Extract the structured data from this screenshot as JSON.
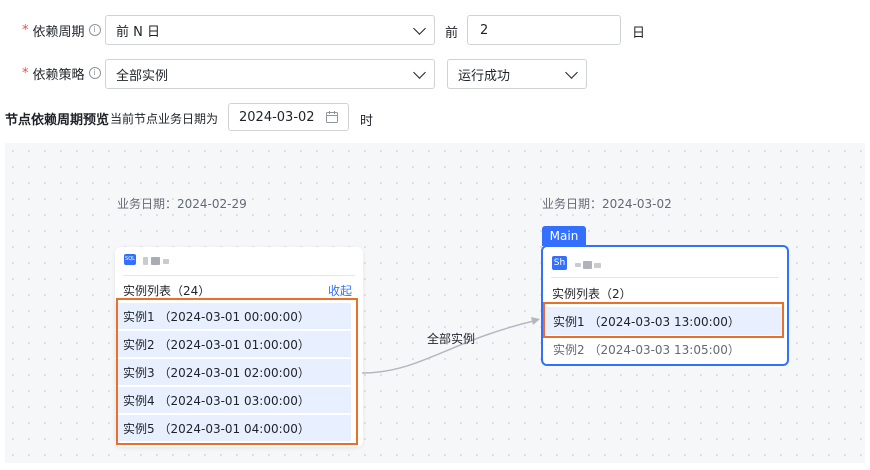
{
  "form": {
    "cycle": {
      "label": "依赖周期",
      "value": "前 N 日",
      "prefix": "前",
      "number": "2",
      "unit": "日"
    },
    "strategy": {
      "label": "依赖策略",
      "value": "全部实例",
      "status": "运行成功"
    },
    "preview": {
      "label": "节点依赖周期预览",
      "hint": "当前节点业务日期为",
      "date": "2024-03-02",
      "suffix": "时"
    }
  },
  "left_node": {
    "date_label": "业务日期：2024-02-29",
    "type_badge": "SQL",
    "list_title": "实例列表（24）",
    "collapse": "收起",
    "instances": [
      "实例1  （2024-03-01 00:00:00）",
      "实例2  （2024-03-01 01:00:00）",
      "实例3  （2024-03-01 02:00:00）",
      "实例4  （2024-03-01 03:00:00）",
      "实例5  （2024-03-01 04:00:00）"
    ]
  },
  "edge_label": "全部实例",
  "right_node": {
    "date_label": "业务日期：2024-03-02",
    "tag": "Main",
    "type_badge": "Sh",
    "list_title": "实例列表（2）",
    "instances": [
      "实例1  （2024-03-03 13:00:00）",
      "实例2  （2024-03-03 13:05:00）"
    ]
  },
  "colors": {
    "accent": "#3370ff",
    "highlight": "#e8702a",
    "selected_row": "#e8f0ff"
  }
}
